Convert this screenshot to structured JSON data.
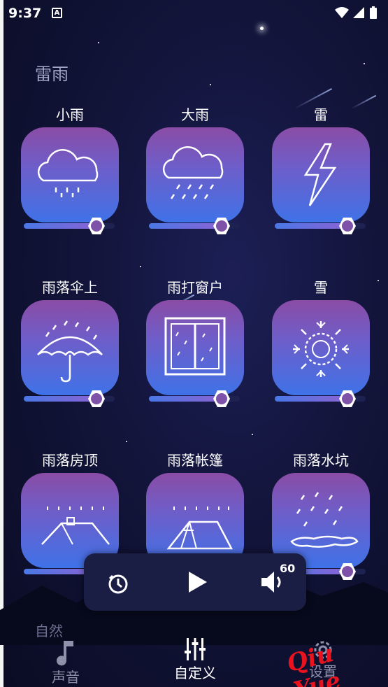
{
  "status_bar": {
    "time": "9:37",
    "notification_letter": "A"
  },
  "section": {
    "title": "雷雨",
    "next_title_partial": "自然"
  },
  "sounds": [
    {
      "label": "小雨",
      "icon": "light-rain-cloud-icon",
      "volume": 0.8
    },
    {
      "label": "大雨",
      "icon": "heavy-rain-cloud-icon",
      "volume": 0.8
    },
    {
      "label": "雷",
      "icon": "lightning-icon",
      "volume": 0.8
    },
    {
      "label": "雨落伞上",
      "icon": "umbrella-rain-icon",
      "volume": 0.8
    },
    {
      "label": "雨打窗户",
      "icon": "window-rain-icon",
      "volume": 0.8
    },
    {
      "label": "雪",
      "icon": "snowflake-icon",
      "volume": 0.8
    },
    {
      "label": "雨落房顶",
      "icon": "roof-rain-icon",
      "volume": 0.8
    },
    {
      "label": "雨落帐篷",
      "icon": "tent-rain-icon",
      "volume": 0.8
    },
    {
      "label": "雨落水坑",
      "icon": "puddle-rain-icon",
      "volume": 0.8
    }
  ],
  "player": {
    "volume": "60",
    "timer_icon": "timer-icon",
    "play_icon": "play-icon",
    "volume_icon": "speaker-icon"
  },
  "nav": {
    "sound_label": "声音",
    "custom_label": "自定义",
    "settings_label": "设置"
  },
  "watermark": "Qiu Yue",
  "colors": {
    "accent": "#7d52a8",
    "tile_top": "#8a4ca5",
    "tile_bottom": "#3f72e8",
    "active_nav": "#ffffff",
    "inactive_nav": "#8f91aa"
  }
}
